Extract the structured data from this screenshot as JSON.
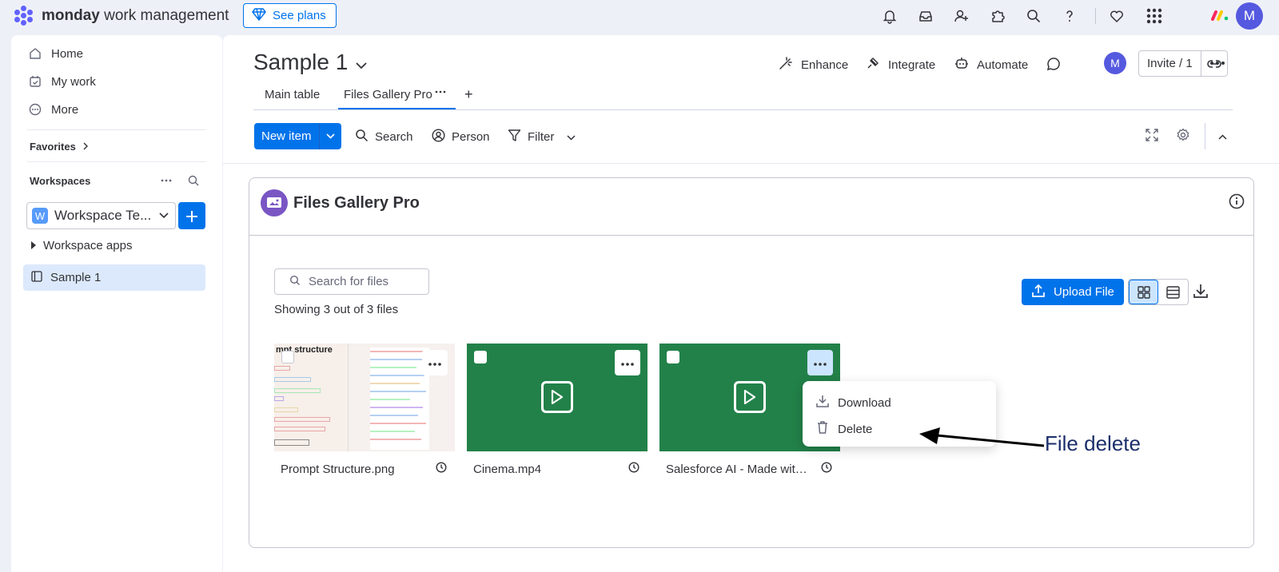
{
  "header": {
    "brand_bold": "monday",
    "brand_rest": " work management",
    "see_plans": "See plans",
    "avatar_initial": "M"
  },
  "sidebar": {
    "nav": [
      {
        "label": "Home",
        "icon": "home-icon"
      },
      {
        "label": "My work",
        "icon": "calendar-check-icon"
      },
      {
        "label": "More",
        "icon": "more-circle-icon"
      }
    ],
    "favorites": "Favorites",
    "workspaces_title": "Workspaces",
    "workspace_badge": "W",
    "workspace_name": "Workspace Te...",
    "workspace_apps": "Workspace apps",
    "board": "Sample 1"
  },
  "board": {
    "title": "Sample 1",
    "actions": {
      "enhance": "Enhance",
      "integrate": "Integrate",
      "automate": "Automate"
    },
    "avatar_initial": "M",
    "invite": "Invite / 1",
    "tabs": [
      {
        "label": "Main table",
        "active": false
      },
      {
        "label": "Files Gallery Pro",
        "active": true
      }
    ],
    "toolbar": {
      "new_item": "New item",
      "search": "Search",
      "person": "Person",
      "filter": "Filter"
    }
  },
  "app": {
    "title": "Files Gallery Pro",
    "search_placeholder": "Search for files",
    "showing": "Showing 3 out of 3 files",
    "upload": "Upload File",
    "files": [
      {
        "name": "Prompt Structure.png",
        "type": "image",
        "thumb_heading": "mpt structure"
      },
      {
        "name": "Cinema.mp4",
        "type": "video"
      },
      {
        "name": "Salesforce AI - Made with ...",
        "type": "video"
      }
    ],
    "context_menu": [
      {
        "label": "Download",
        "icon": "download-icon"
      },
      {
        "label": "Delete",
        "icon": "trash-icon"
      }
    ]
  },
  "annotation": {
    "text": "File delete"
  },
  "colors": {
    "primary": "#0073ea",
    "video_thumb": "#228149",
    "annotation": "#1c2f6b",
    "avatar": "#5559df"
  }
}
